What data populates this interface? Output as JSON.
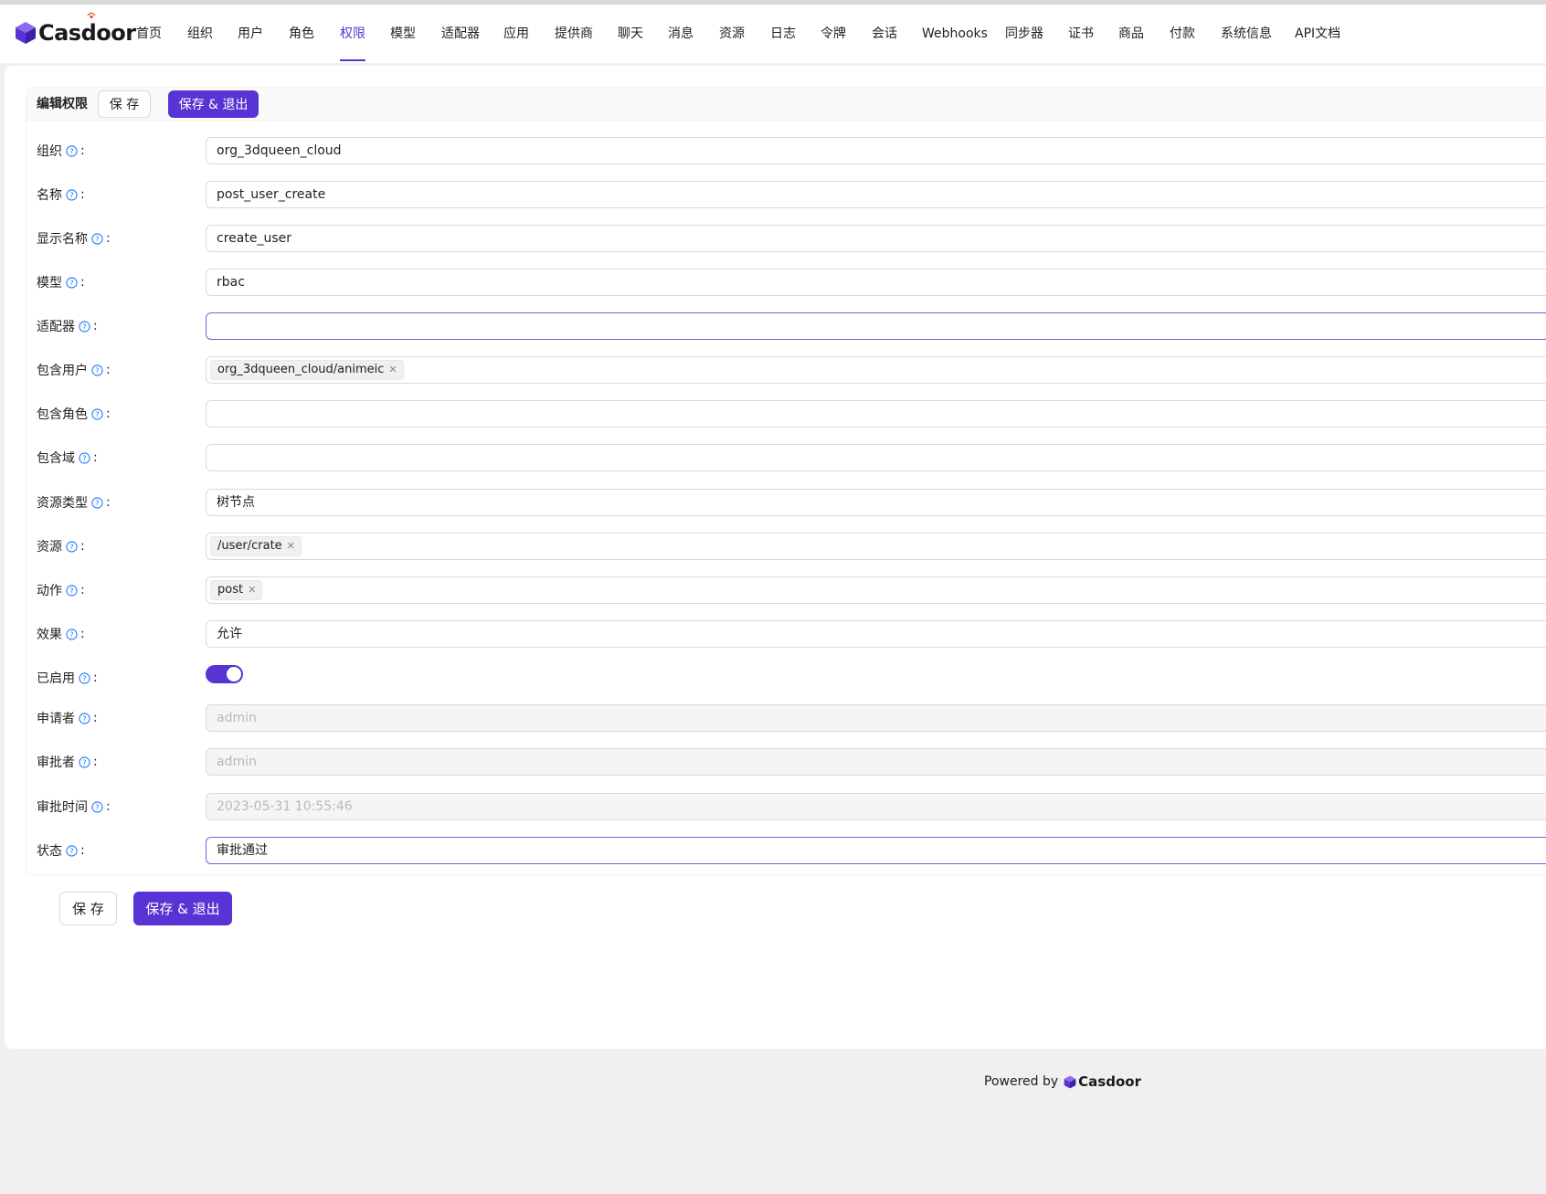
{
  "app": {
    "logo_text": "Casdoor"
  },
  "nav": {
    "items": [
      {
        "label": "首页"
      },
      {
        "label": "组织"
      },
      {
        "label": "用户"
      },
      {
        "label": "角色"
      },
      {
        "label": "权限"
      },
      {
        "label": "模型"
      },
      {
        "label": "适配器"
      },
      {
        "label": "应用"
      },
      {
        "label": "提供商"
      },
      {
        "label": "聊天"
      },
      {
        "label": "消息"
      },
      {
        "label": "资源"
      },
      {
        "label": "日志"
      },
      {
        "label": "令牌"
      },
      {
        "label": "会话"
      },
      {
        "label": "Webhooks"
      },
      {
        "label": "同步器"
      },
      {
        "label": "证书"
      },
      {
        "label": "商品"
      },
      {
        "label": "付款"
      },
      {
        "label": "系统信息"
      },
      {
        "label": "API文档"
      }
    ],
    "active": "权限"
  },
  "header": {
    "title": "编辑权限",
    "save_label": "保 存",
    "save_exit_label": "保存 & 退出"
  },
  "form": {
    "organization": {
      "label": "组织",
      "value": "org_3dqueen_cloud"
    },
    "name": {
      "label": "名称",
      "value": "post_user_create"
    },
    "display_name": {
      "label": "显示名称",
      "value": "create_user"
    },
    "model": {
      "label": "模型",
      "value": "rbac"
    },
    "adapter": {
      "label": "适配器",
      "value": ""
    },
    "users": {
      "label": "包含用户",
      "tags": [
        "org_3dqueen_cloud/animeic"
      ]
    },
    "roles": {
      "label": "包含角色",
      "value": ""
    },
    "domains": {
      "label": "包含域",
      "value": ""
    },
    "resource_type": {
      "label": "资源类型",
      "value": "树节点"
    },
    "resources": {
      "label": "资源",
      "tags": [
        "/user/crate"
      ]
    },
    "actions": {
      "label": "动作",
      "tags": [
        "post"
      ]
    },
    "effect": {
      "label": "效果",
      "value": "允许"
    },
    "enabled": {
      "label": "已启用",
      "value": true
    },
    "submitter": {
      "label": "申请者",
      "value": "admin"
    },
    "approver": {
      "label": "审批者",
      "value": "admin"
    },
    "approve_time": {
      "label": "审批时间",
      "value": "2023-05-31 10:55:46"
    },
    "state": {
      "label": "状态",
      "value": "审批通过"
    }
  },
  "bottom": {
    "save_label": "保 存",
    "save_exit_label": "保存 & 退出"
  },
  "footer": {
    "powered_by": "Powered by",
    "logo_text": "Casdoor"
  },
  "colors": {
    "primary": "#5734d3",
    "help_icon": "#1677ff"
  }
}
